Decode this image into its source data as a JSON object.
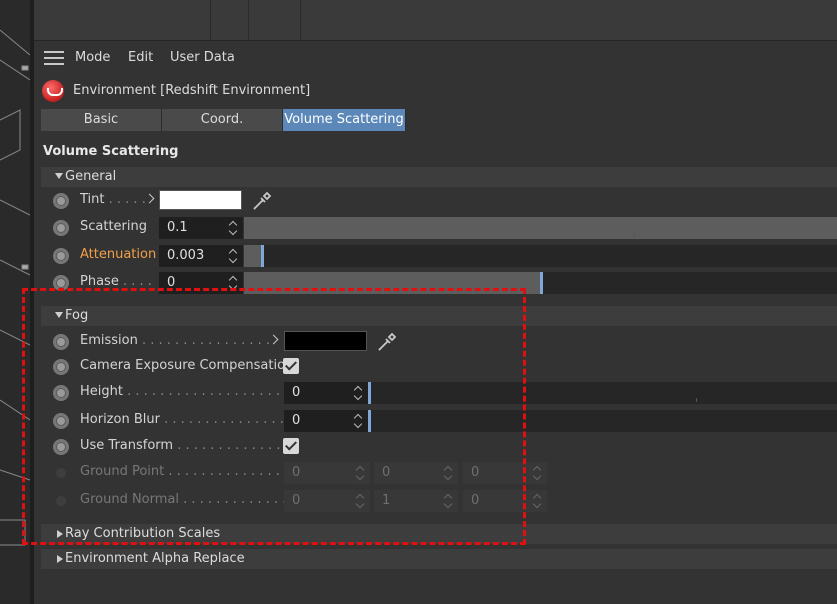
{
  "menu": {
    "mode": "Mode",
    "edit": "Edit",
    "user_data": "User Data"
  },
  "object": {
    "title": "Environment [Redshift Environment]"
  },
  "tabs": [
    {
      "label": "Basic",
      "active": false
    },
    {
      "label": "Coord.",
      "active": false
    },
    {
      "label": "Volume Scattering",
      "active": true
    }
  ],
  "section_title": "Volume Scattering",
  "groups": {
    "general": "General",
    "fog": "Fog",
    "ray_contribution": "Ray Contribution Scales",
    "env_alpha": "Environment Alpha Replace"
  },
  "general": {
    "tint": {
      "label": "Tint",
      "dots": " . . . . .",
      "color": "#ffffff"
    },
    "scattering": {
      "label": "Scattering",
      "value": "0.1",
      "level": 1.0
    },
    "attenuation": {
      "label": "Attenuation",
      "value": "0.003",
      "level": 0.03
    },
    "phase": {
      "label": "Phase",
      "dots": " . . . .",
      "value": "0",
      "level": 0.5
    }
  },
  "fog": {
    "emission": {
      "label": "Emission",
      "dots": " . . . . . . . . . . . . . . . .",
      "color": "#000000"
    },
    "camera_exposure": {
      "label": "Camera Exposure Compensation",
      "checked": true
    },
    "height": {
      "label": "Height",
      "dots": " . . . . . . . . . . . . . . . . . . . .",
      "value": "0"
    },
    "horizon_blur": {
      "label": "Horizon Blur",
      "dots": " . . . . . . . . . . . . . . . .",
      "value": "0"
    },
    "use_transform": {
      "label": "Use Transform",
      "dots": " . . . . . . . . . . . . . .",
      "checked": true
    },
    "ground_point": {
      "label": "Ground Point",
      "dots": " . . . . . . . . . . . . . . .",
      "values": [
        "0",
        "0",
        "0"
      ]
    },
    "ground_normal": {
      "label": "Ground Normal",
      "dots": " . . . . . . . . . . . . .",
      "values": [
        "0",
        "1",
        "0"
      ]
    }
  },
  "colors": {
    "accent": "#5b88b8",
    "highlight_label": "#f0a04a",
    "annotation": "#e01010"
  }
}
